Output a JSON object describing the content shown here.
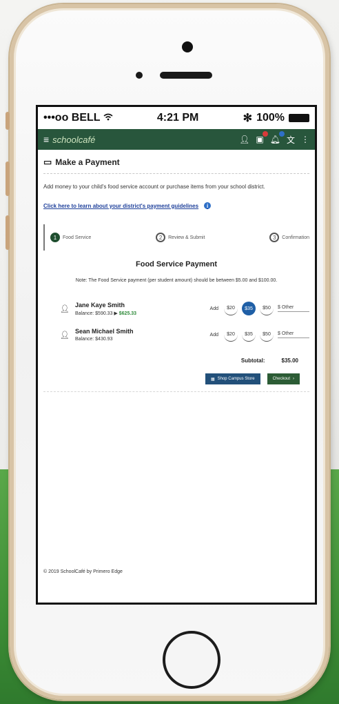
{
  "status_bar": {
    "carrier": "•••oo BELL",
    "time": "4:21 PM",
    "battery": "100%"
  },
  "app_bar": {
    "brand": "schoolcafé",
    "badge_colors": {
      "cart": "#d93a3a",
      "notifications": "#2e6fc7"
    },
    "icons": [
      "hamburger-icon",
      "user-icon",
      "cart-icon",
      "bell-icon",
      "language-icon",
      "more-icon"
    ]
  },
  "page": {
    "title": "Make a Payment",
    "intro": "Add money to your child's food service account or purchase items from your school district.",
    "rules_link": "Click here to learn about your district's payment guidelines",
    "info_glyph": "i"
  },
  "steps": [
    {
      "number": "1",
      "label": "Food Service",
      "active": true
    },
    {
      "number": "2",
      "label": "Review & Submit",
      "active": false
    },
    {
      "number": "3",
      "label": "Confirmation",
      "active": false
    }
  ],
  "payment": {
    "title": "Food Service Payment",
    "note": "Note: The Food Service payment (per student amount) should be between $5.00 and $100.00.",
    "add_label": "Add",
    "students": [
      {
        "name": "Jane Kaye Smith",
        "balance_label": "Balance: $590.33",
        "arrow": "▶",
        "new_balance": "$625.33",
        "amounts": [
          "$20",
          "$35",
          "$50"
        ],
        "selected_index": 1,
        "other_label": "$ Other"
      },
      {
        "name": "Sean Michael Smith",
        "balance_label": "Balance: $430.93",
        "arrow": "",
        "new_balance": "",
        "amounts": [
          "$20",
          "$35",
          "$50"
        ],
        "selected_index": -1,
        "other_label": "$ Other"
      }
    ],
    "subtotal_label": "Subtotal:",
    "subtotal_value": "$35.00"
  },
  "buttons": {
    "campus_store": "Shop Campus Store",
    "checkout": "Checkout",
    "checkout_arrow": "›"
  },
  "footer": "© 2019 SchoolCafé by Primero Edge",
  "colors": {
    "app_bar": "#28563c",
    "step_active": "#1f4e2f",
    "selected_amount": "#1f5fa6",
    "campus_store_button": "#22507a",
    "checkout_button": "#2c5c35",
    "new_balance": "#2f8a3a"
  }
}
